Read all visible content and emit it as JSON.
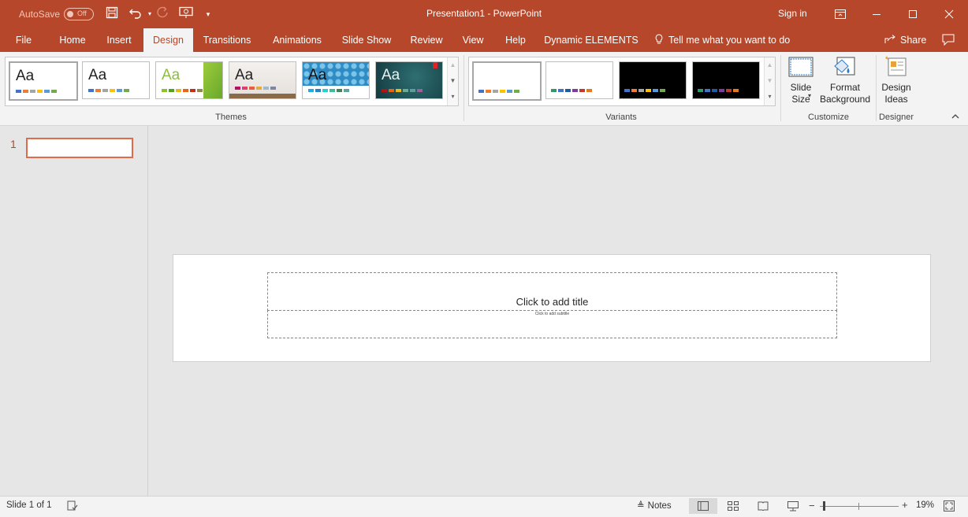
{
  "titlebar": {
    "autosave_label": "AutoSave",
    "autosave_state": "Off",
    "title": "Presentation1  -  PowerPoint",
    "signin": "Sign in"
  },
  "tabs": [
    "File",
    "Home",
    "Insert",
    "Design",
    "Transitions",
    "Animations",
    "Slide Show",
    "Review",
    "View",
    "Help",
    "Dynamic ELEMENTS"
  ],
  "active_tab": "Design",
  "tell_me": "Tell me what you want to do",
  "share": "Share",
  "ribbon": {
    "themes_label": "Themes",
    "variants_label": "Variants",
    "customize_label": "Customize",
    "designer_label": "Designer",
    "theme_thumb_text": "Aa",
    "slide_size": "Slide Size",
    "format_background": "Format Background",
    "design_ideas": "Design Ideas"
  },
  "slides_pane": {
    "slide_number": "1"
  },
  "slide": {
    "title_placeholder": "Click to add title",
    "subtitle_placeholder": "Click to add subtitle"
  },
  "status": {
    "slide_info": "Slide 1 of 1",
    "notes": "Notes",
    "zoom": "19%"
  },
  "colors": {
    "accent": "#b7472a",
    "ribbon_bg": "#f3f3f3"
  }
}
